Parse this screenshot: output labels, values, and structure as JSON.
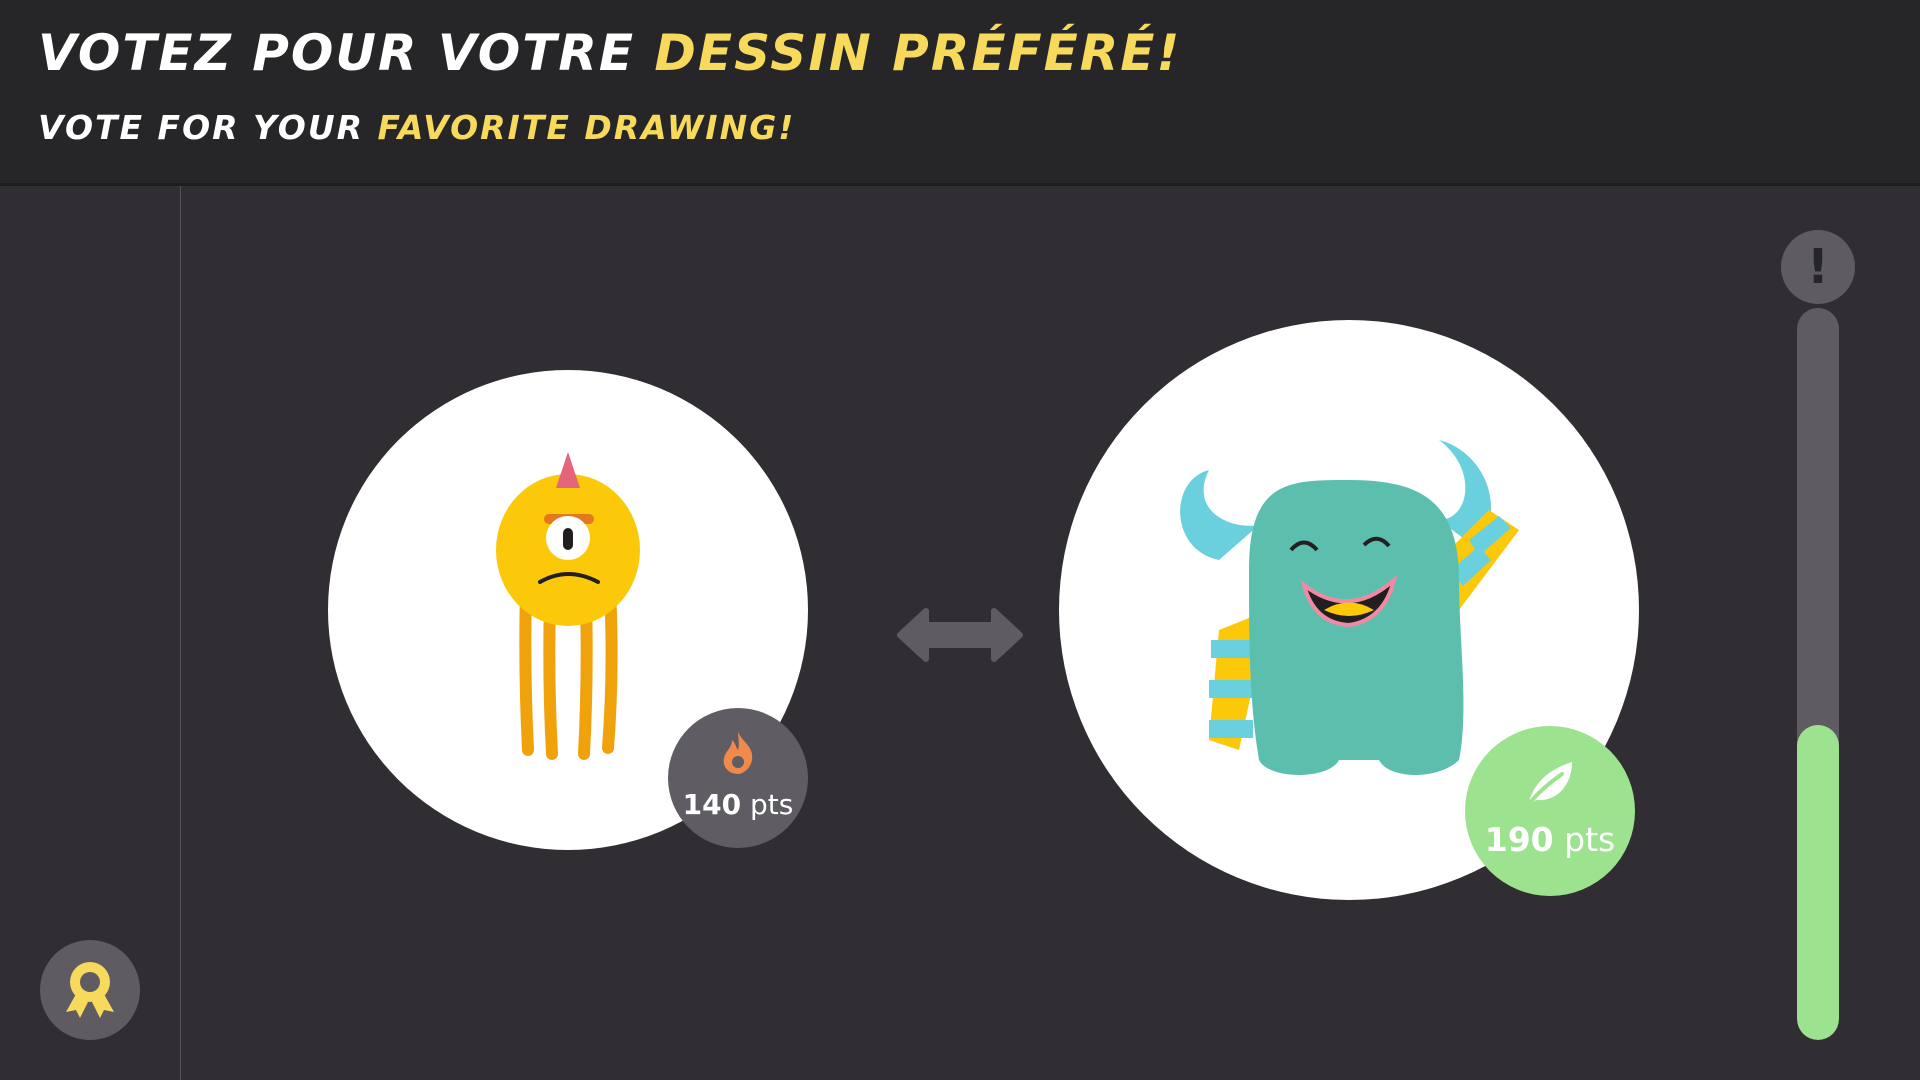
{
  "header": {
    "title_fr_prefix": "VOTEZ POUR VOTRE",
    "title_fr_accent": "DESSIN PRÉFÉRÉ!",
    "title_en_prefix": "VOTE FOR YOUR",
    "title_en_accent": "FAVORITE DRAWING!"
  },
  "drawings": {
    "left": {
      "subject": "yellow one-eyed monster",
      "score_value": "140",
      "score_unit": "pts",
      "badge_icon": "flame-icon"
    },
    "right": {
      "subject": "teal horned monster",
      "score_value": "190",
      "score_unit": "pts",
      "badge_icon": "leaf-icon"
    }
  },
  "swap_icon": "double-arrow-icon",
  "alert_symbol": "!",
  "award_icon": "award-ribbon-icon",
  "vote_progress": 0.43,
  "colors": {
    "background": "#312e33",
    "header": "#262528",
    "accent_yellow": "#f7d95c",
    "badge_gray": "#5f5d63",
    "badge_green": "#9de28f",
    "progress_green": "#9de28f"
  }
}
